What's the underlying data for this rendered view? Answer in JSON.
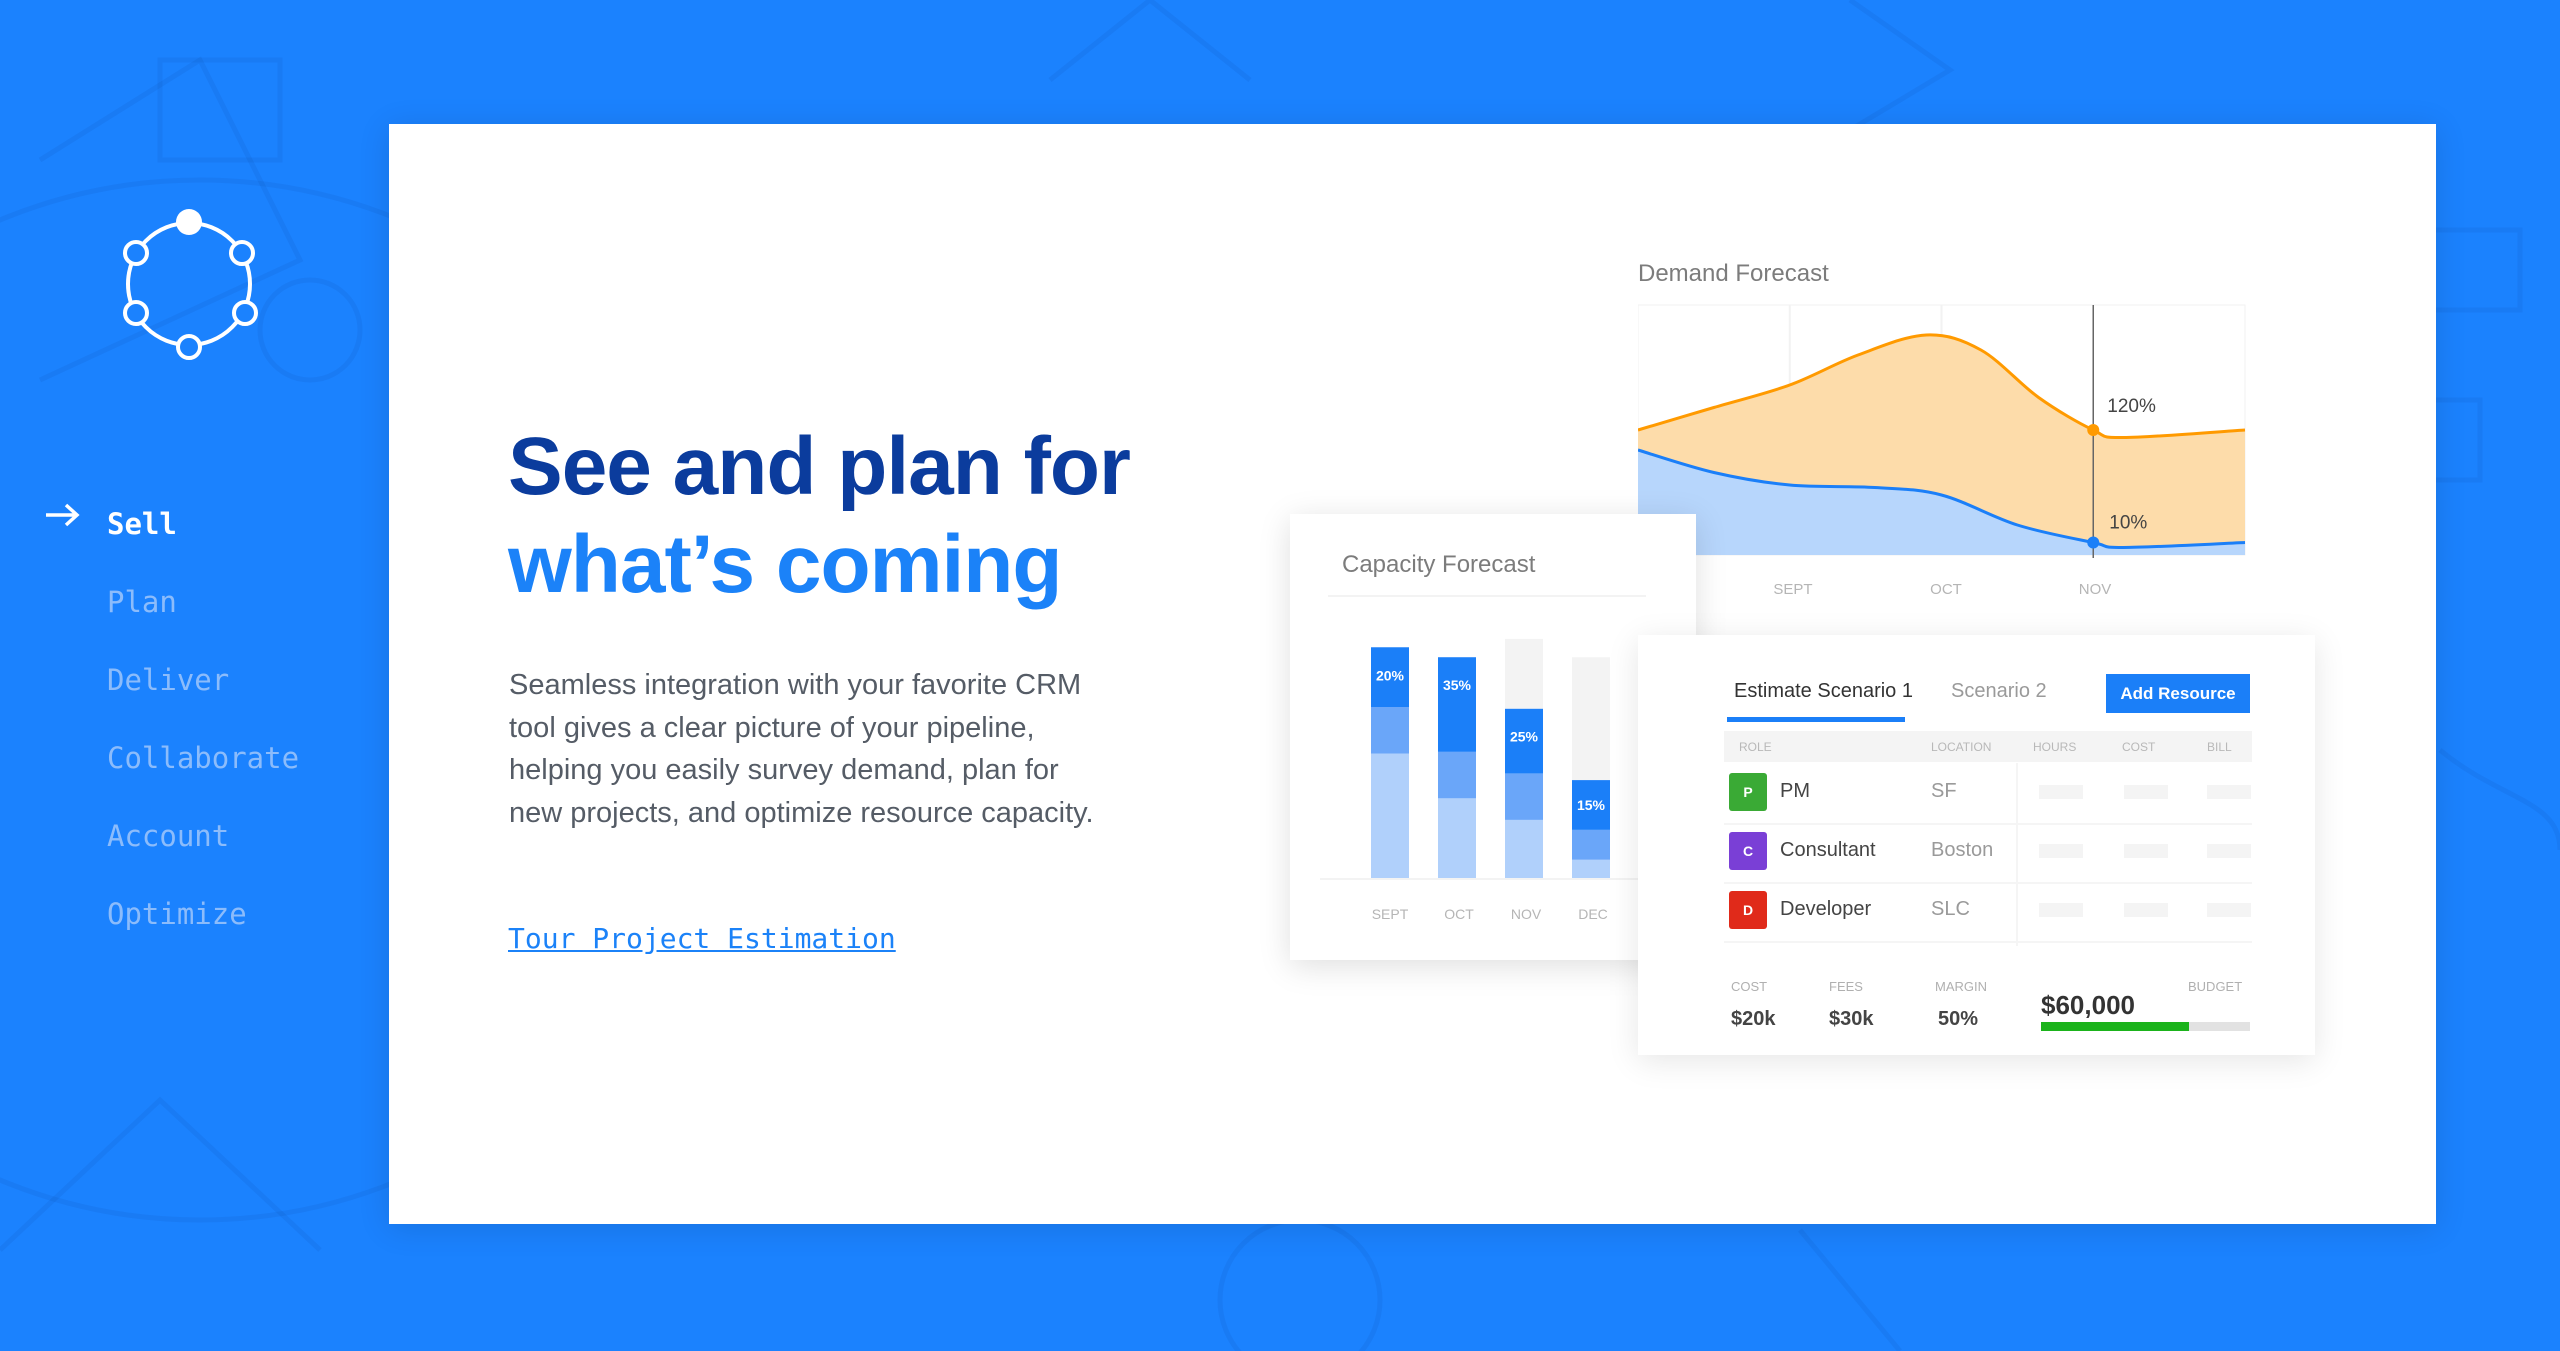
{
  "colors": {
    "background": "#1b82fe",
    "headline_dark": "#0b3c9d",
    "headline_accent": "#1b82f8",
    "orange": "#ff9a00",
    "blue": "#1b7ff8",
    "budget_green": "#1bb31b"
  },
  "logo": {
    "icon": "circle-of-nodes-logo"
  },
  "nav": {
    "items": [
      {
        "label": "Sell",
        "active": true
      },
      {
        "label": "Plan",
        "active": false
      },
      {
        "label": "Deliver",
        "active": false
      },
      {
        "label": "Collaborate",
        "active": false
      },
      {
        "label": "Account",
        "active": false
      },
      {
        "label": "Optimize",
        "active": false
      }
    ],
    "active_icon": "arrow-right-icon"
  },
  "hero": {
    "headline_line1": "See and plan for",
    "headline_line2": "what’s coming",
    "paragraph": "Seamless integration with your favorite CRM tool gives a clear picture of your pipeline, helping you easily survey demand, plan for new projects, and optimize resource capacity.",
    "link": "Tour Project Estimation"
  },
  "chart_data": [
    {
      "type": "area",
      "title": "Demand Forecast",
      "categories": [
        "SEPT",
        "OCT",
        "NOV"
      ],
      "x_note_units": "month index (SEPT=1, OCT=2, NOV=3)",
      "series": [
        {
          "color": "#ff9a00",
          "x": [
            0,
            0.5,
            1,
            1.45,
            1.9,
            2.26,
            2.64,
            3,
            3.2,
            4
          ],
          "values": [
            50,
            59,
            68,
            80,
            88,
            82,
            63,
            50,
            47,
            50
          ]
        },
        {
          "color": "#1b7ff8",
          "x": [
            0,
            0.5,
            1,
            1.56,
            2,
            2.5,
            3,
            3.2,
            4
          ],
          "values": [
            42,
            33,
            28,
            27,
            24,
            12,
            5,
            3,
            5
          ]
        }
      ],
      "marker": {
        "x": 3,
        "labels": [
          "120%",
          "10%"
        ]
      },
      "ylim": [
        0,
        100
      ],
      "grid": true
    },
    {
      "type": "bar",
      "title": "Capacity Forecast",
      "stacked": true,
      "categories": [
        "SEPT",
        "OCT",
        "NOV",
        "DEC"
      ],
      "series": [
        {
          "color": "#b0d0fb",
          "values": [
            75,
            48,
            35,
            11
          ]
        },
        {
          "color": "#6aa6f9",
          "values": [
            28,
            28,
            28,
            18
          ]
        },
        {
          "color": "#1b7ff8",
          "values": [
            36,
            57,
            39,
            30
          ]
        },
        {
          "color": "#f3f3f3",
          "values": [
            0,
            0,
            42,
            74
          ]
        }
      ],
      "data_labels": [
        "20%",
        "35%",
        "25%",
        "15%"
      ]
    }
  ],
  "estimate": {
    "tabs": [
      {
        "label": "Estimate Scenario 1",
        "active": true
      },
      {
        "label": "Scenario 2",
        "active": false
      }
    ],
    "add_button": "Add Resource",
    "columns": [
      "ROLE",
      "LOCATION",
      "HOURS",
      "COST",
      "BILL"
    ],
    "rows": [
      {
        "initial": "P",
        "role": "PM",
        "location": "SF",
        "color": "#3aaa35"
      },
      {
        "initial": "C",
        "role": "Consultant",
        "location": "Boston",
        "color": "#7a3fd6"
      },
      {
        "initial": "D",
        "role": "Developer",
        "location": "SLC",
        "color": "#e02a1a"
      }
    ],
    "summary": {
      "cost_label": "COST",
      "cost": "$20k",
      "fees_label": "FEES",
      "fees": "$30k",
      "margin_label": "MARGIN",
      "margin": "50%",
      "budget_label": "BUDGET",
      "budget": "$60,000",
      "budget_used_percent": 71
    }
  }
}
